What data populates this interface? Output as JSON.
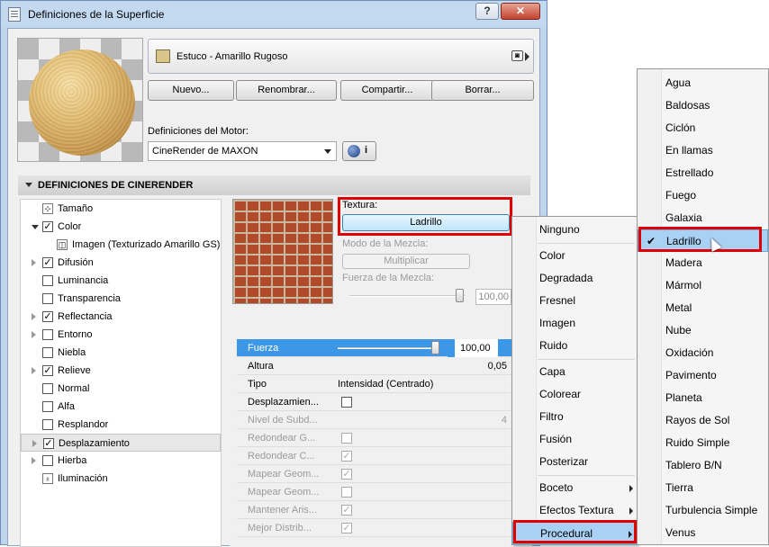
{
  "window": {
    "title": "Definiciones de la Superficie",
    "help": "?",
    "close": "✕"
  },
  "material": {
    "name": "Estuco - Amarillo Rugoso",
    "swatch_color": "#d9c48a"
  },
  "buttons": {
    "new": "Nuevo...",
    "rename": "Renombrar...",
    "share": "Compartir...",
    "delete": "Borrar..."
  },
  "engine": {
    "label": "Definiciones del Motor:",
    "value": "CineRender de MAXON",
    "info": "i"
  },
  "section": {
    "title": "DEFINICIONES DE CINERENDER"
  },
  "tree": [
    {
      "label": "Tamaño",
      "checkbox": null,
      "expander": "none",
      "icon": "size-icon"
    },
    {
      "label": "Color",
      "checkbox": true,
      "expander": "open"
    },
    {
      "label": "Imagen (Texturizado Amarillo GS)",
      "checkbox": null,
      "expander": "none",
      "icon": "image-icon"
    },
    {
      "label": "Difusión",
      "checkbox": true,
      "expander": "closed"
    },
    {
      "label": "Luminancia",
      "checkbox": false,
      "expander": "none"
    },
    {
      "label": "Transparencia",
      "checkbox": false,
      "expander": "none"
    },
    {
      "label": "Reflectancia",
      "checkbox": true,
      "expander": "closed"
    },
    {
      "label": "Entorno",
      "checkbox": false,
      "expander": "closed"
    },
    {
      "label": "Niebla",
      "checkbox": false,
      "expander": "none"
    },
    {
      "label": "Relieve",
      "checkbox": true,
      "expander": "closed"
    },
    {
      "label": "Normal",
      "checkbox": false,
      "expander": "none"
    },
    {
      "label": "Alfa",
      "checkbox": false,
      "expander": "none"
    },
    {
      "label": "Resplandor",
      "checkbox": false,
      "expander": "none"
    },
    {
      "label": "Desplazamiento",
      "checkbox": true,
      "expander": "closed",
      "selected": true
    },
    {
      "label": "Hierba",
      "checkbox": false,
      "expander": "closed"
    },
    {
      "label": "Iluminación",
      "checkbox": null,
      "expander": "none",
      "icon": "lighting-icon"
    }
  ],
  "texture": {
    "label": "Textura:",
    "button": "Ladrillo"
  },
  "blend": {
    "mode_label": "Modo de la Mezcla:",
    "mode_button": "Multiplicar",
    "strength_label": "Fuerza de la Mezcla:",
    "strength_value": "100,00",
    "strength_fraction": 1.0
  },
  "props": [
    {
      "label": "Fuerza",
      "value": "100,00",
      "type": "slider",
      "fraction": 1.0,
      "selected": true
    },
    {
      "label": "Altura",
      "value": "0,05",
      "type": "text_right"
    },
    {
      "label": "Tipo",
      "value": "Intensidad (Centrado)",
      "type": "text_left"
    },
    {
      "label": "Desplazamien...",
      "value": false,
      "type": "checkbox"
    },
    {
      "label": "Nivel de Subd...",
      "value": "4",
      "type": "text_right",
      "disabled": true
    },
    {
      "label": "Redondear G...",
      "value": false,
      "type": "checkbox",
      "disabled": true
    },
    {
      "label": "Redondear C...",
      "value": true,
      "type": "checkbox",
      "disabled": true
    },
    {
      "label": "Mapear Geom...",
      "value": true,
      "type": "checkbox",
      "disabled": true
    },
    {
      "label": "Mapear Geom...",
      "value": false,
      "type": "checkbox",
      "disabled": true
    },
    {
      "label": "Mantener Aris...",
      "value": true,
      "type": "checkbox",
      "disabled": true
    },
    {
      "label": "Mejor Distrib...",
      "value": true,
      "type": "checkbox",
      "disabled": true
    }
  ],
  "menu1": [
    {
      "label": "Ninguno"
    },
    {
      "sep": true
    },
    {
      "label": "Color"
    },
    {
      "label": "Degradada"
    },
    {
      "label": "Fresnel"
    },
    {
      "label": "Imagen"
    },
    {
      "label": "Ruido"
    },
    {
      "sep": true
    },
    {
      "label": "Capa"
    },
    {
      "label": "Colorear"
    },
    {
      "label": "Filtro"
    },
    {
      "label": "Fusión"
    },
    {
      "label": "Posterizar"
    },
    {
      "sep": true
    },
    {
      "label": "Boceto",
      "submenu": true
    },
    {
      "label": "Efectos Textura",
      "submenu": true
    },
    {
      "label": "Procedural",
      "submenu": true,
      "highlighted": true
    }
  ],
  "menu2": [
    {
      "label": "Agua"
    },
    {
      "label": "Baldosas"
    },
    {
      "label": "Ciclón"
    },
    {
      "label": "En llamas"
    },
    {
      "label": "Estrellado"
    },
    {
      "label": "Fuego"
    },
    {
      "label": "Galaxia"
    },
    {
      "label": "Ladrillo",
      "checked": true,
      "highlighted": true
    },
    {
      "label": "Madera"
    },
    {
      "label": "Mármol"
    },
    {
      "label": "Metal"
    },
    {
      "label": "Nube"
    },
    {
      "label": "Oxidación"
    },
    {
      "label": "Pavimento"
    },
    {
      "label": "Planeta"
    },
    {
      "label": "Rayos de Sol"
    },
    {
      "label": "Ruido Simple"
    },
    {
      "label": "Tablero B/N"
    },
    {
      "label": "Tierra"
    },
    {
      "label": "Turbulencia Simple"
    },
    {
      "label": "Venus"
    }
  ],
  "colors": {
    "selection": "#3c98e6",
    "menu_highlight": "#a8d1f5",
    "annotation": "#e00000"
  }
}
